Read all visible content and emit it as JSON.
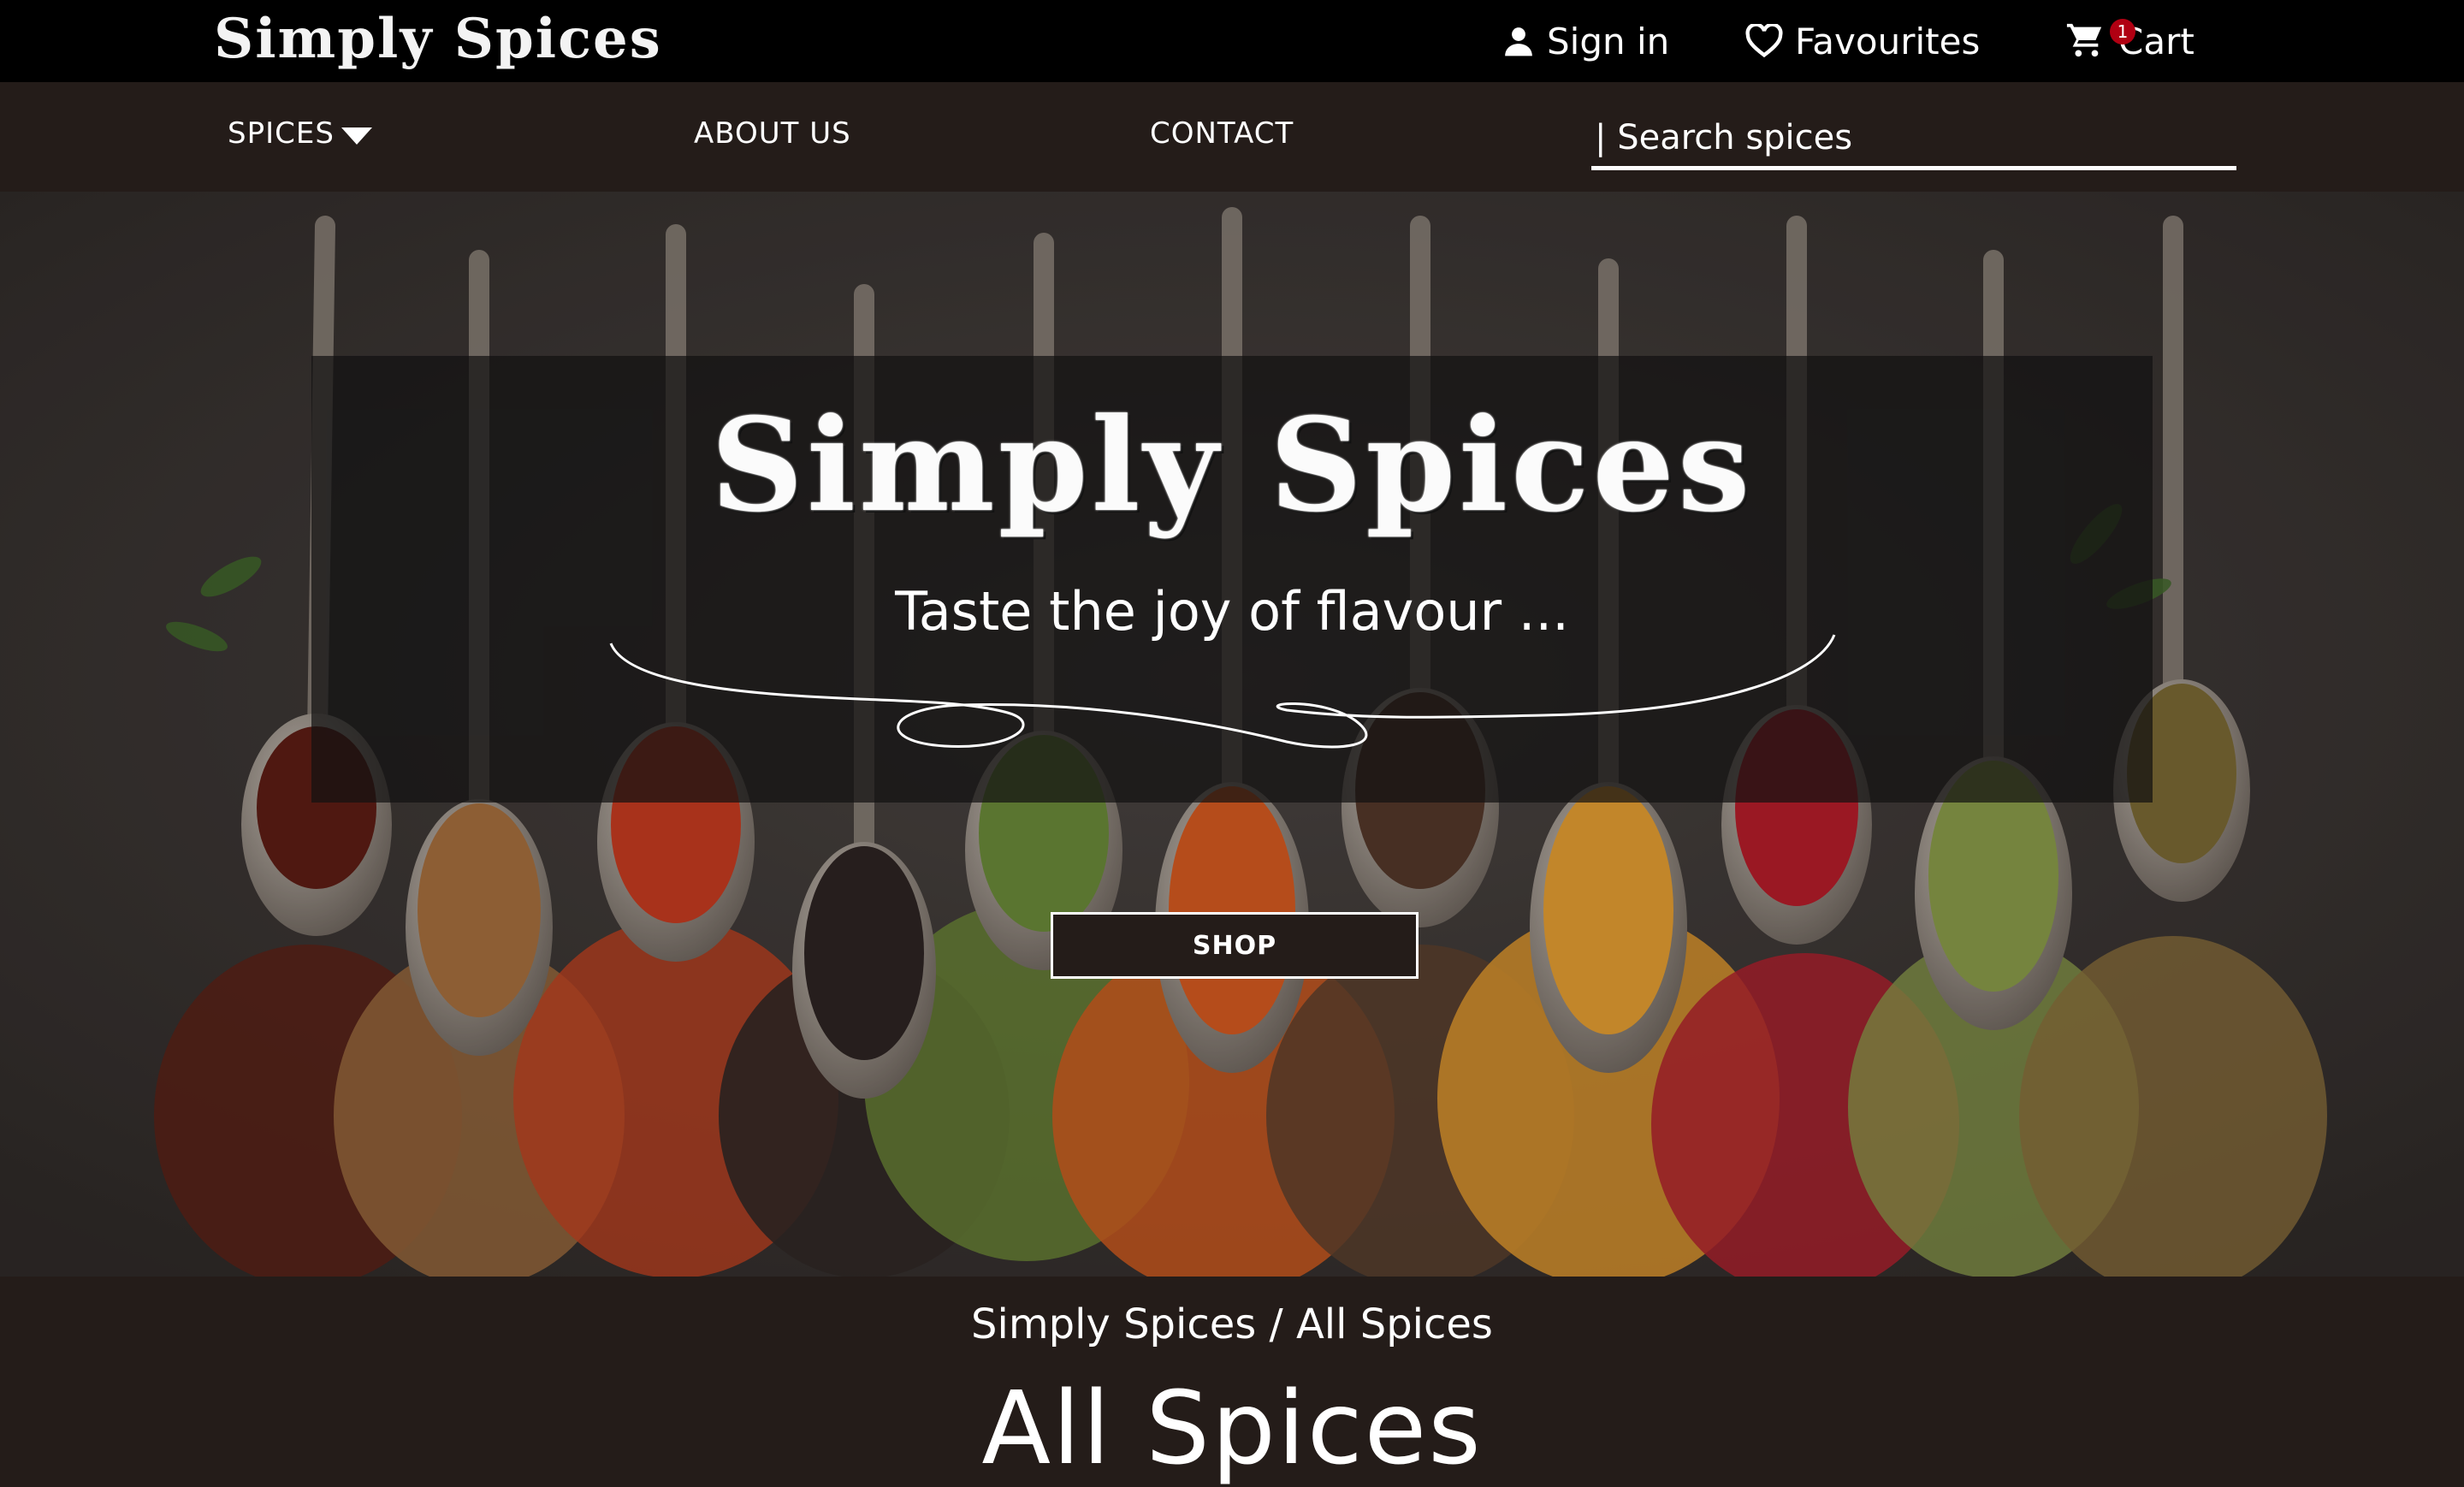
{
  "header": {
    "logo": "Simply Spices",
    "signin_label": "Sign in",
    "favourites_label": "Favourites",
    "cart_label": "Cart",
    "cart_count": "1"
  },
  "nav": {
    "spices_label": "SPICES",
    "about_label": "ABOUT US",
    "contact_label": "CONTACT",
    "search_placeholder": "| Search spices"
  },
  "hero": {
    "title": "Simply Spices",
    "tagline": "Taste the joy of flavour ...",
    "shop_label": "SHOP"
  },
  "breadcrumb": "Simply Spices / All Spices",
  "page_title": "All Spices",
  "colors": {
    "topbar": "#000000",
    "navbar": "#241c19",
    "cart_badge": "#b00012",
    "text": "#ffffff"
  },
  "icons": [
    "user-icon",
    "heart-icon",
    "cart-icon",
    "caret-down-icon"
  ]
}
